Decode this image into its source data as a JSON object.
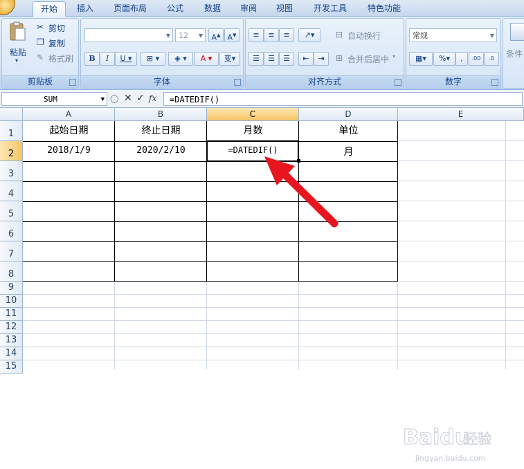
{
  "ribbon_tabs": [
    "开始",
    "插入",
    "页面布局",
    "公式",
    "数据",
    "审阅",
    "视图",
    "开发工具",
    "特色功能"
  ],
  "clipboard": {
    "paste": "粘贴",
    "cut": "剪切",
    "copy": "复制",
    "format_painter": "格式刷",
    "label": "剪贴板"
  },
  "font": {
    "name_value": "",
    "size_value": "12",
    "label": "字体"
  },
  "alignment": {
    "wrap_text": "自动换行",
    "merge_center": "合并后居中",
    "label": "对齐方式"
  },
  "number": {
    "format_value": "常规",
    "label": "数字"
  },
  "styles": {
    "conditional": "条件"
  },
  "formula_bar": {
    "name_box": "SUM",
    "formula": "=DATEDIF()"
  },
  "columns": [
    "A",
    "B",
    "C",
    "D",
    "E"
  ],
  "rows": [
    "1",
    "2",
    "3",
    "4",
    "5",
    "6",
    "7",
    "8",
    "9",
    "10",
    "11",
    "12",
    "13",
    "14",
    "15"
  ],
  "cells": {
    "A1": "起始日期",
    "B1": "终止日期",
    "C1": "月数",
    "D1": "单位",
    "A2": "2018/1/9",
    "B2": "2020/2/10",
    "C2": "=DATEDIF()",
    "D2": "月"
  },
  "colors": {
    "ribbon_bg": "#d4e3f5",
    "selected_header": "#f6c565",
    "arrow": "#e8141e"
  },
  "watermark": {
    "brand": "Baidu",
    "sub": "经验",
    "url": "jingyan.baidu.com"
  }
}
